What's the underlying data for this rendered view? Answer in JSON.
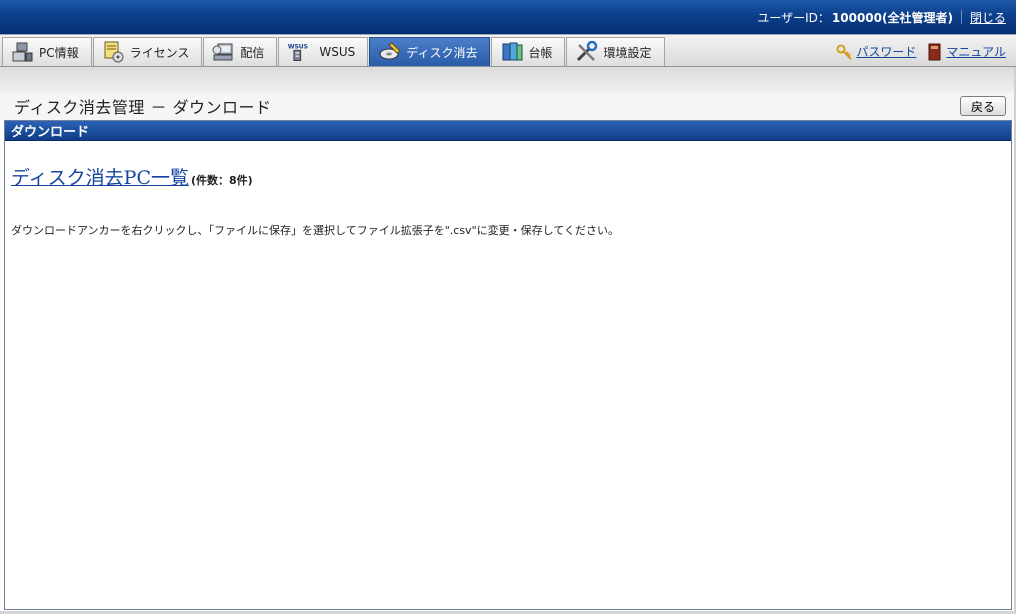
{
  "header": {
    "user_id_label": "ユーザーID：",
    "user_id_value": "100000(全社管理者)",
    "close_label": "閉じる"
  },
  "tabs": [
    {
      "label": "PC情報",
      "icon": "pc-icon"
    },
    {
      "label": "ライセンス",
      "icon": "license-icon"
    },
    {
      "label": "配信",
      "icon": "distribution-icon"
    },
    {
      "label": "WSUS",
      "icon": "wsus-icon",
      "icon_text": "WSUS"
    },
    {
      "label": "ディスク消去",
      "icon": "disk-erase-icon",
      "active": true
    },
    {
      "label": "台帳",
      "icon": "ledger-icon"
    },
    {
      "label": "環境設定",
      "icon": "settings-icon"
    }
  ],
  "tools": {
    "password_label": "パスワード",
    "manual_label": "マニュアル"
  },
  "page": {
    "title": "ディスク消去管理 － ダウンロード",
    "back_label": "戻る"
  },
  "panel": {
    "header": "ダウンロード",
    "download_link": "ディスク消去PC一覧",
    "count_text": "(件数：8件)",
    "note": "ダウンロードアンカーを右クリックし、「ファイルに保存」を選択してファイル拡張子を\".csv\"に変更・保存してください。"
  },
  "colors": {
    "header_blue": "#0c3f8c",
    "active_tab": "#2a5ca8",
    "link": "#1446a0"
  }
}
